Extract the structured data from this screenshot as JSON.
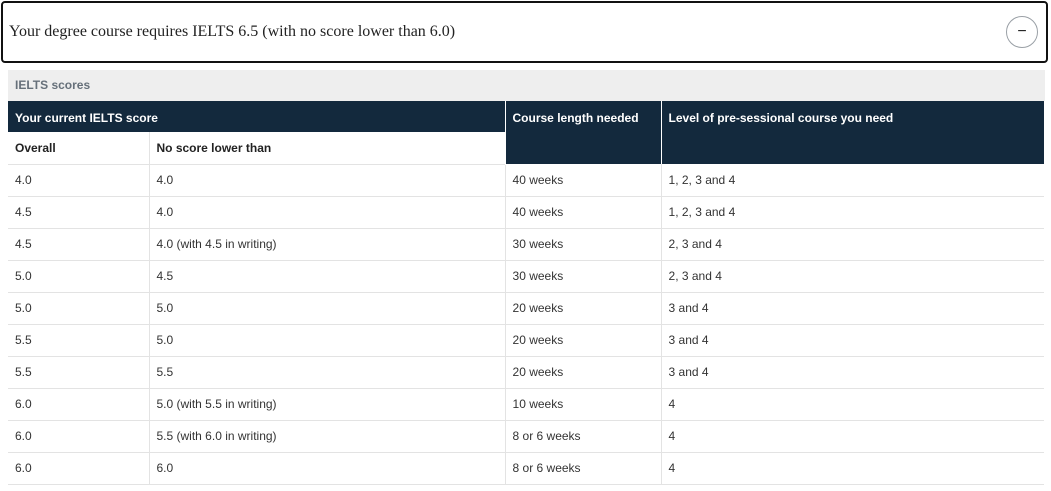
{
  "accordion": {
    "title": "Your degree course requires IELTS 6.5 (with no score lower than 6.0)",
    "toggle_symbol": "−"
  },
  "table": {
    "caption": "IELTS scores",
    "headers": {
      "current_score": "Your current IELTS score",
      "overall": "Overall",
      "no_score_lower": "No score lower than",
      "course_length": "Course length needed",
      "level": "Level of pre-sessional course you need"
    },
    "rows": [
      {
        "overall": "4.0",
        "min": "4.0",
        "length": "40 weeks",
        "level": "1, 2, 3 and 4"
      },
      {
        "overall": "4.5",
        "min": "4.0",
        "length": "40 weeks",
        "level": "1, 2, 3 and 4"
      },
      {
        "overall": "4.5",
        "min": "4.0 (with 4.5 in writing)",
        "length": "30 weeks",
        "level": "2, 3 and 4"
      },
      {
        "overall": "5.0",
        "min": "4.5",
        "length": "30 weeks",
        "level": "2, 3 and 4"
      },
      {
        "overall": "5.0",
        "min": "5.0",
        "length": "20 weeks",
        "level": "3 and 4"
      },
      {
        "overall": "5.5",
        "min": "5.0",
        "length": "20 weeks",
        "level": "3 and 4"
      },
      {
        "overall": "5.5",
        "min": "5.5",
        "length": "20 weeks",
        "level": "3 and 4"
      },
      {
        "overall": "6.0",
        "min": "5.0 (with 5.5 in writing)",
        "length": "10 weeks",
        "level": "4"
      },
      {
        "overall": "6.0",
        "min": "5.5 (with 6.0 in writing)",
        "length": "8 or 6 weeks",
        "level": "4"
      },
      {
        "overall": "6.0",
        "min": "6.0",
        "length": "8 or 6 weeks",
        "level": "4"
      }
    ]
  }
}
